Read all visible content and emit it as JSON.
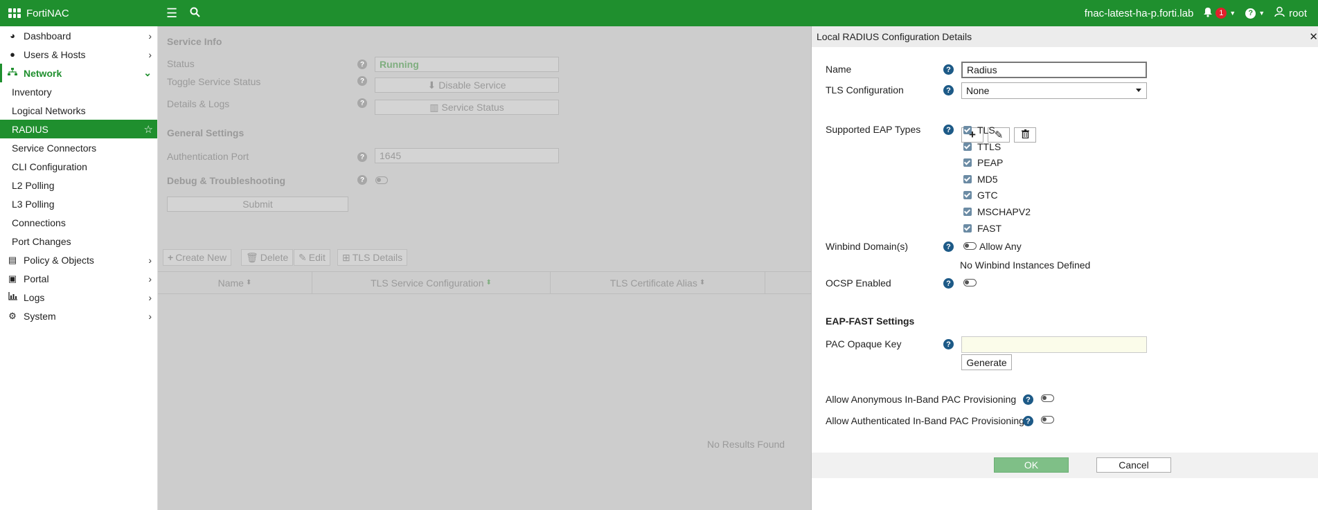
{
  "topbar": {
    "app_name": "FortiNAC",
    "host": "fnac-latest-ha-p.forti.lab",
    "notification_count": "1",
    "user": "root"
  },
  "sidebar": {
    "items": [
      {
        "label": "Dashboard"
      },
      {
        "label": "Users & Hosts"
      },
      {
        "label": "Network"
      },
      {
        "label": "Inventory"
      },
      {
        "label": "Logical Networks"
      },
      {
        "label": "RADIUS"
      },
      {
        "label": "Service Connectors"
      },
      {
        "label": "CLI Configuration"
      },
      {
        "label": "L2 Polling"
      },
      {
        "label": "L3 Polling"
      },
      {
        "label": "Connections"
      },
      {
        "label": "Port Changes"
      },
      {
        "label": "Policy & Objects"
      },
      {
        "label": "Portal"
      },
      {
        "label": "Logs"
      },
      {
        "label": "System"
      }
    ]
  },
  "main": {
    "service_info": "Service Info",
    "status_label": "Status",
    "status_value": "Running",
    "toggle_label": "Toggle Service Status",
    "disable_btn": "Disable Service",
    "details_label": "Details & Logs",
    "service_status_btn": "Service Status",
    "general_settings": "General Settings",
    "auth_port_label": "Authentication Port",
    "auth_port_value": "1645",
    "debug_label": "Debug & Troubleshooting",
    "submit": "Submit",
    "create_new": "Create New",
    "delete": "Delete",
    "edit": "Edit",
    "tls_details": "TLS Details",
    "col_name": "Name",
    "col_tls_service": "TLS Service Configuration",
    "col_tls_cert": "TLS Certificate Alias",
    "no_results": "No Results Found"
  },
  "panel": {
    "title": "Local RADIUS Configuration Details",
    "name_label": "Name",
    "name_value": "Radius",
    "tls_label": "TLS Configuration",
    "tls_value": "None",
    "eap_label": "Supported EAP Types",
    "eap_types": [
      "TLS",
      "TTLS",
      "PEAP",
      "MD5",
      "GTC",
      "MSCHAPV2",
      "FAST"
    ],
    "winbind_label": "Winbind Domain(s)",
    "allow_any": "Allow Any",
    "no_winbind": "No Winbind Instances Defined",
    "ocsp_label": "OCSP Enabled",
    "eap_fast_settings": "EAP-FAST Settings",
    "pac_key_label": "PAC Opaque Key",
    "pac_key_value": "",
    "generate": "Generate",
    "anon_label": "Allow Anonymous In-Band PAC Provisioning",
    "auth_label": "Allow Authenticated In-Band PAC Provisioning",
    "ok": "OK",
    "cancel": "Cancel"
  }
}
